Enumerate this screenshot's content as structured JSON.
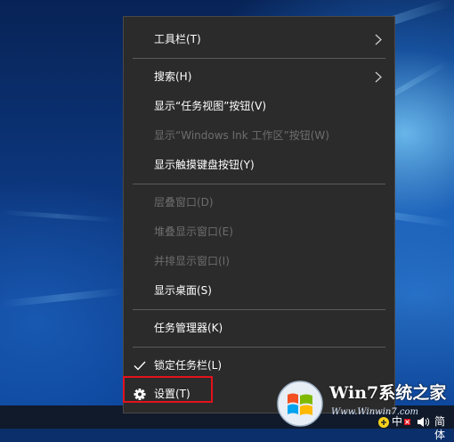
{
  "context_menu": {
    "items": [
      {
        "label": "工具栏(T)",
        "has_submenu": true,
        "enabled": true
      },
      {
        "label": "搜索(H)",
        "has_submenu": true,
        "enabled": true
      },
      {
        "label": "显示“任务视图”按钮(V)",
        "enabled": true
      },
      {
        "label": "显示“Windows Ink 工作区”按钮(W)",
        "enabled": false
      },
      {
        "label": "显示触摸键盘按钮(Y)",
        "enabled": true
      },
      {
        "label": "层叠窗口(D)",
        "enabled": false
      },
      {
        "label": "堆叠显示窗口(E)",
        "enabled": false
      },
      {
        "label": "并排显示窗口(I)",
        "enabled": false
      },
      {
        "label": "显示桌面(S)",
        "enabled": true
      },
      {
        "label": "任务管理器(K)",
        "enabled": true
      },
      {
        "label": "锁定任务栏(L)",
        "checked": true,
        "enabled": true
      },
      {
        "label": "设置(T)",
        "icon": "gear-icon",
        "enabled": true,
        "highlighted": true
      }
    ]
  },
  "taskbar": {
    "tray": {
      "network_label": "中",
      "volume_icon": "volume-icon",
      "ime_label": "简体"
    }
  },
  "watermark": {
    "brand": "Win7",
    "brand_suffix": "系统之家",
    "site": "Www.Winwin7.com"
  },
  "colors": {
    "menu_bg": "#2b2b2b",
    "highlight_border": "#e3121b",
    "disabled_text": "#6d6d6d"
  }
}
